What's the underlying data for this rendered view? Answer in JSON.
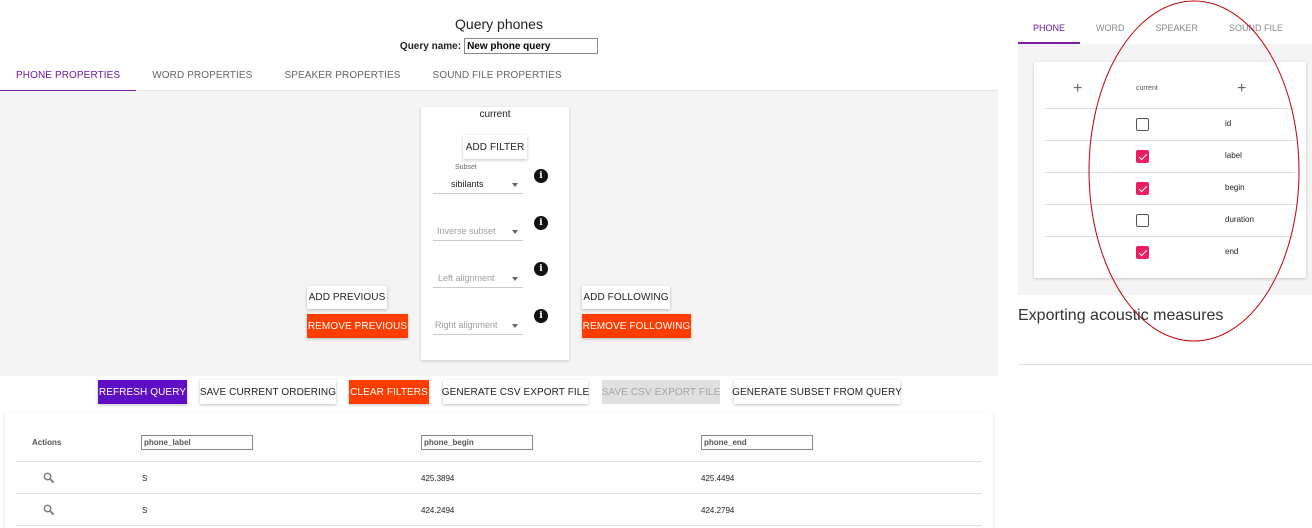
{
  "page": {
    "title": "Query phones",
    "query_name_label": "Query name:",
    "query_name_value": "New phone query"
  },
  "tabs": [
    "PHONE PROPERTIES",
    "WORD PROPERTIES",
    "SPEAKER PROPERTIES",
    "SOUND FILE PROPERTIES"
  ],
  "filter": {
    "current_label": "current",
    "add_filter": "ADD FILTER",
    "subset_label": "Subset",
    "subset_value": "sibilants",
    "inverse_subset_placeholder": "Inverse subset",
    "left_alignment_placeholder": "Left alignment",
    "right_alignment_placeholder": "Right alignment",
    "info_icon_glyph": "i",
    "add_previous": "ADD PREVIOUS",
    "remove_previous": "REMOVE PREVIOUS",
    "add_following": "ADD FOLLOWING",
    "remove_following": "REMOVE FOLLOWING"
  },
  "actions": {
    "refresh": "REFRESH QUERY",
    "save_ordering": "SAVE CURRENT ORDERING",
    "clear_filters": "CLEAR FILTERS",
    "generate_csv": "GENERATE CSV EXPORT FILE",
    "save_csv": "SAVE CSV EXPORT FILE",
    "generate_subset": "GENERATE SUBSET FROM QUERY"
  },
  "results": {
    "actions_header": "Actions",
    "columns": [
      "phone_label",
      "phone_begin",
      "phone_end"
    ],
    "rows": [
      {
        "label": "S",
        "begin": "425.3894",
        "end": "425.4494"
      },
      {
        "label": "S",
        "begin": "424.2494",
        "end": "424.2794"
      }
    ]
  },
  "right_tabs": [
    "PHONE",
    "WORD",
    "SPEAKER",
    "SOUND FILE"
  ],
  "columns_panel": {
    "plus_glyph": "+",
    "header": "current",
    "rows": [
      {
        "label": "id",
        "checked": false
      },
      {
        "label": "label",
        "checked": true
      },
      {
        "label": "begin",
        "checked": true
      },
      {
        "label": "duration",
        "checked": false
      },
      {
        "label": "end",
        "checked": true
      }
    ]
  },
  "export": {
    "title": "Exporting acoustic measures"
  },
  "colors": {
    "tab_accent": "#7b1fa2",
    "primary_button": "#5e0fc6",
    "warn_button": "#ff3d00",
    "checkbox_checked": "#e91e63",
    "annotation_ellipse": "#c00000"
  }
}
